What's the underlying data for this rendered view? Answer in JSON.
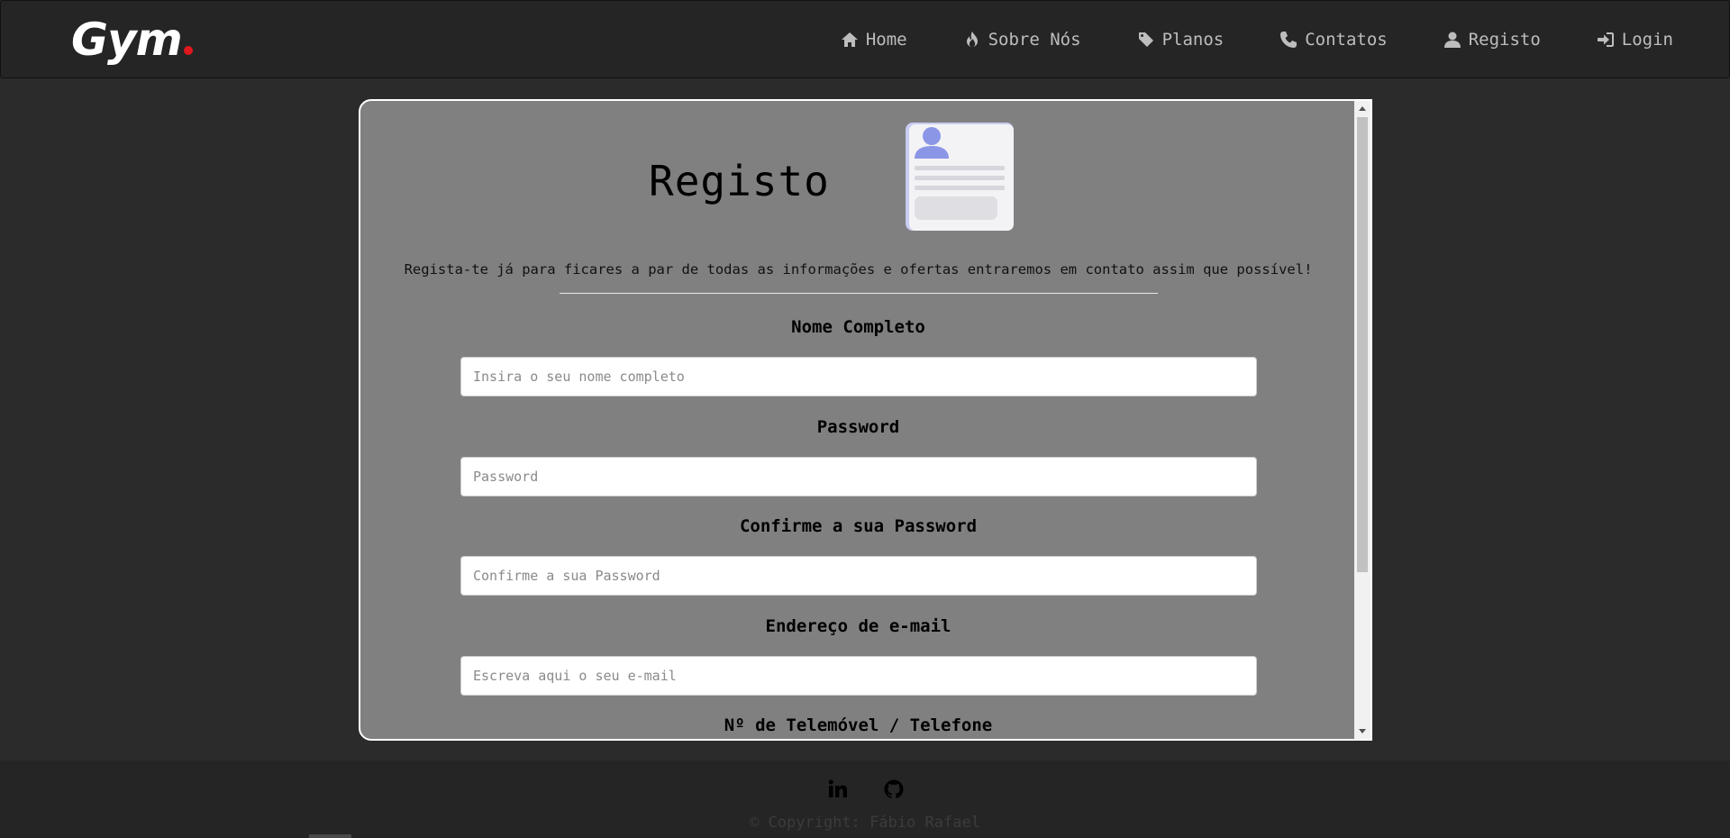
{
  "brand": {
    "name": "Gym",
    "accent_color": "#e0181e"
  },
  "nav": {
    "items": [
      {
        "label": "Home",
        "icon": "home-icon"
      },
      {
        "label": "Sobre Nós",
        "icon": "fire-icon"
      },
      {
        "label": "Planos",
        "icon": "tag-icon"
      },
      {
        "label": "Contatos",
        "icon": "phone-icon"
      },
      {
        "label": "Registo",
        "icon": "user-icon"
      },
      {
        "label": "Login",
        "icon": "login-icon"
      }
    ]
  },
  "form": {
    "title": "Registo",
    "subtitle": "Regista-te já para ficares a par de todas as informações e ofertas entraremos em contato assim que possível!",
    "fields": [
      {
        "label": "Nome Completo",
        "placeholder": "Insira o seu nome completo"
      },
      {
        "label": "Password",
        "placeholder": "Password"
      },
      {
        "label": "Confirme a sua Password",
        "placeholder": "Confirme a sua Password"
      },
      {
        "label": "Endereço de e-mail",
        "placeholder": "Escreva aqui o seu e-mail"
      },
      {
        "label": "Nº de Telemóvel / Telefone"
      }
    ]
  },
  "footer": {
    "social": [
      {
        "name": "LinkedIn",
        "icon": "linkedin-icon"
      },
      {
        "name": "GitHub",
        "icon": "github-icon"
      }
    ],
    "copyright": "© Copyright: Fábio Rafael"
  },
  "colors": {
    "background": "#2b2b2b",
    "navbar": "#252525",
    "panel": "#808080"
  }
}
